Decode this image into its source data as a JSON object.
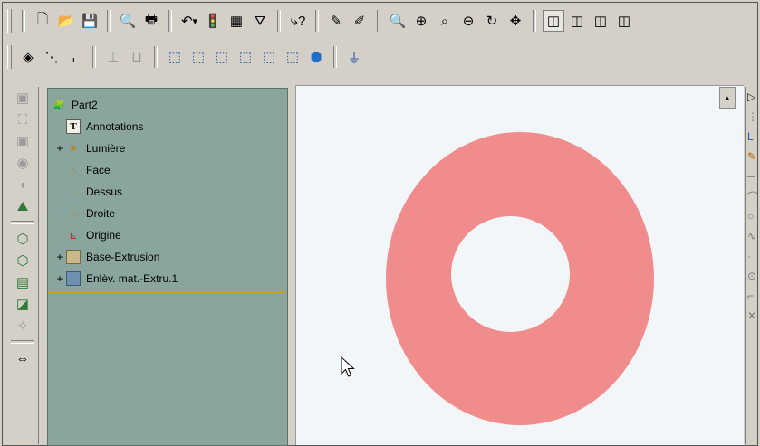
{
  "toolbar1": {
    "buttons": [
      "new-icon",
      "open-icon",
      "save-icon",
      "print-preview-icon",
      "print-icon",
      "undo-icon",
      "rebuild-icon",
      "options-grid-icon",
      "filter-icon",
      "help-icon",
      "sketch-icon",
      "select-icon",
      "zoom-fit-icon",
      "zoom-in-icon",
      "zoom-area-icon",
      "zoom-out-icon",
      "rotate-icon",
      "pan-icon",
      "wireframe-view-icon",
      "hidden-lines-icon",
      "hidden-removed-icon",
      "shaded-view-icon"
    ]
  },
  "toolbar2": {
    "buttons": [
      "plane-icon",
      "axis-icon",
      "point-icon",
      "mate-icon",
      "curve-icon",
      "front-view-icon",
      "back-view-icon",
      "left-view-icon",
      "right-view-icon",
      "top-view-icon",
      "bottom-view-icon",
      "isometric-icon",
      "normal-to-icon"
    ]
  },
  "feature_tree": {
    "root": "Part2",
    "items": [
      {
        "label": "Annotations",
        "expander": "",
        "icon": "annotations-icon"
      },
      {
        "label": "Lumière",
        "expander": "+",
        "icon": "lighting-icon"
      },
      {
        "label": "Face",
        "expander": "",
        "icon": "plane-icon"
      },
      {
        "label": "Dessus",
        "expander": "",
        "icon": "plane-icon"
      },
      {
        "label": "Droite",
        "expander": "",
        "icon": "plane-icon"
      },
      {
        "label": "Origine",
        "expander": "",
        "icon": "origin-icon"
      },
      {
        "label": "Base-Extrusion",
        "expander": "+",
        "icon": "extrude-icon"
      },
      {
        "label": "Enlèv. mat.-Extru.1",
        "expander": "+",
        "icon": "cut-extrude-icon"
      }
    ]
  },
  "viewport": {
    "model_color": "#f08c8c",
    "background_color": "#f2f6f8"
  }
}
